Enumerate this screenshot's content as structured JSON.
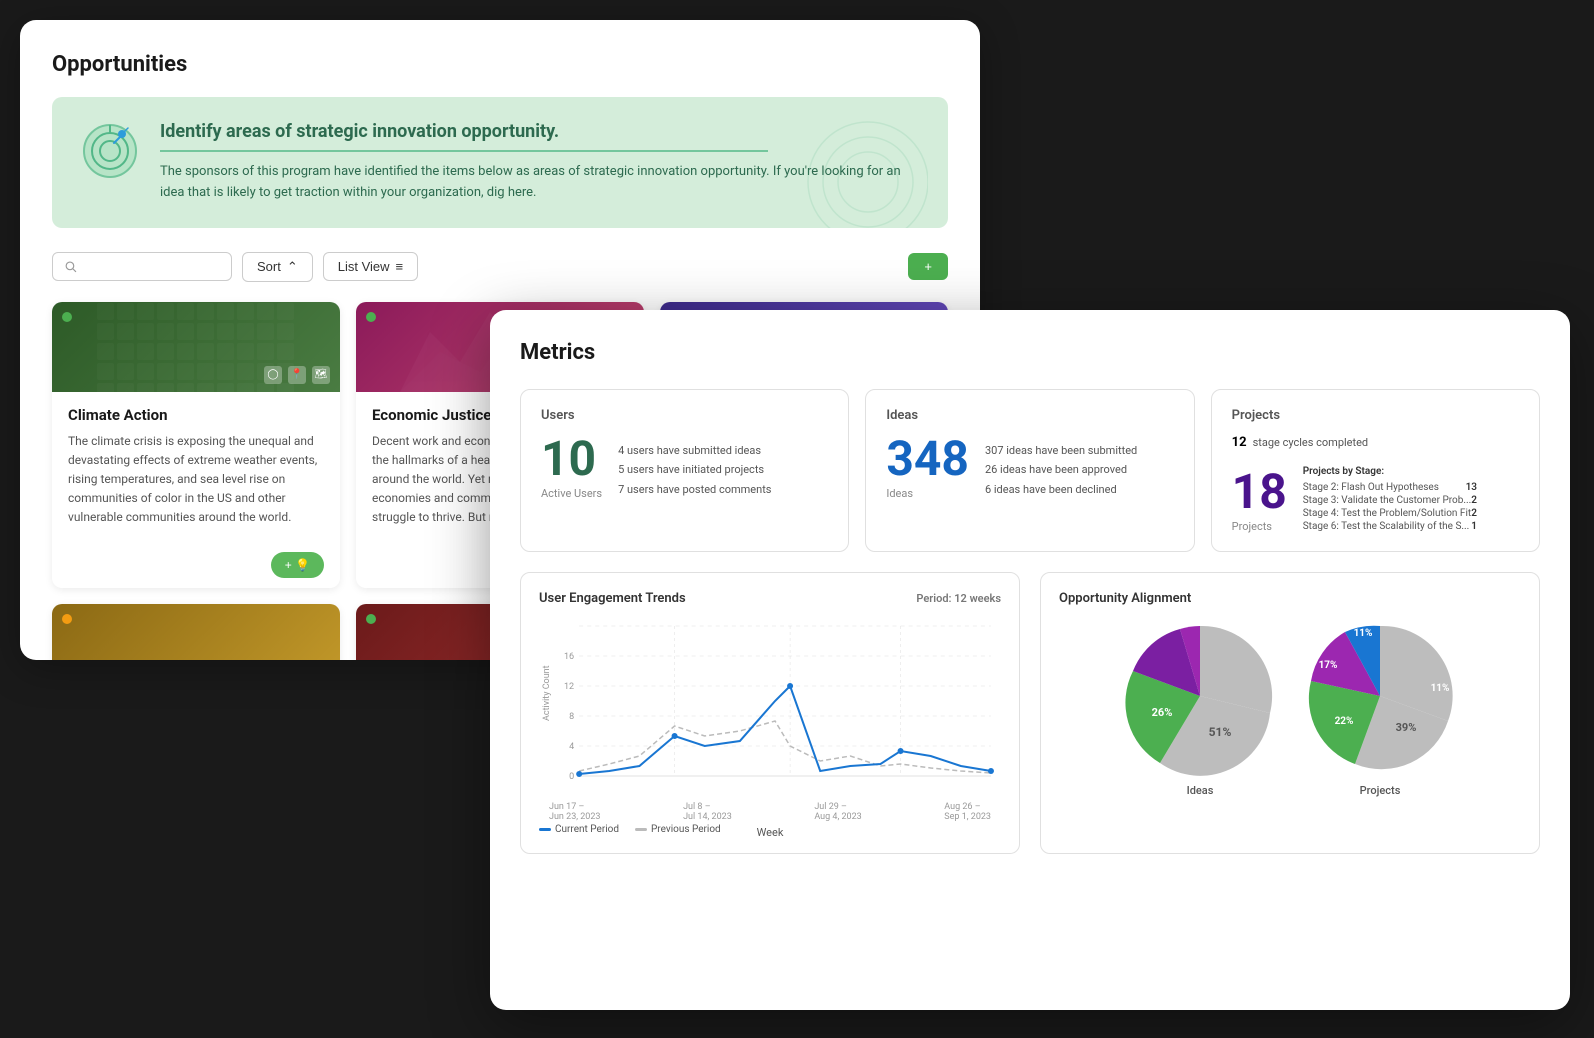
{
  "back_panel": {
    "title": "Opportunities",
    "banner": {
      "title": "Identify areas of strategic innovation opportunity.",
      "text": "The sponsors of this program have identified the items below as areas of strategic innovation opportunity. If you're looking for an idea that is likely to get traction within your organization, dig here."
    },
    "filter": {
      "sort_label": "Sort",
      "listview_label": "List View",
      "search_placeholder": ""
    },
    "cards": [
      {
        "id": "climate-action",
        "title": "Climate Action",
        "description": "The climate crisis is exposing the unequal and devastating effects of extreme weather events, rising temperatures, and sea level rise on communities of color in the US and other vulnerable communities around the world.",
        "header_class": "card-header-green",
        "add_label": "+ 💡"
      },
      {
        "id": "economic-justice",
        "title": "Economic Justice",
        "description": "Decent work and economic growth are among the hallmarks of a healthy, thriving community around the world. Yet many local and regional economies and communities continue to struggle to thrive. But m...",
        "header_class": "card-header-pink",
        "add_label": ""
      },
      {
        "id": "third-card",
        "title": "",
        "description": "",
        "header_class": "card-header-purple",
        "add_label": ""
      }
    ],
    "bottom_cards": [
      {
        "id": "card-gold",
        "header_class": "card-header-gold"
      },
      {
        "id": "card-darkred",
        "header_class": "card-header-darkred"
      }
    ]
  },
  "front_panel": {
    "title": "Metrics",
    "users": {
      "label": "Users",
      "number": "10",
      "sublabel": "Active Users",
      "details": [
        "4  users have submitted ideas",
        "5  users have initiated projects",
        "7  users have posted comments"
      ]
    },
    "ideas": {
      "label": "Ideas",
      "number": "348",
      "sublabel": "Ideas",
      "details": [
        "307  ideas have been submitted",
        "26   ideas have been approved",
        "6    ideas have been declined"
      ]
    },
    "projects": {
      "label": "Projects",
      "number": "18",
      "sublabel": "Projects",
      "cycle_count": "12",
      "cycle_text": "stage cycles completed",
      "stage_label": "Projects by Stage:",
      "stages": [
        {
          "name": "Stage 2: Flash Out Hypotheses",
          "count": 13
        },
        {
          "name": "Stage 3: Validate the Customer Prob...",
          "count": 2
        },
        {
          "name": "Stage 4: Test the Problem/Solution Fit",
          "count": 2
        },
        {
          "name": "Stage 6: Test the Scalability of the S...",
          "count": 1
        }
      ]
    },
    "engagement": {
      "title": "User Engagement Trends",
      "period": "Period: 12 weeks",
      "y_label": "Activity Count",
      "x_label": "Week",
      "legend_current": "Current Period",
      "legend_previous": "Previous Period",
      "x_axis": [
        "Jun 17 – Jun 23, 2023",
        "Jul 8 – Jul 14, 2023",
        "Jul 29 – Aug 4, 2023",
        "Aug 26 – Sep 1, 2023"
      ],
      "y_ticks": [
        0,
        4,
        8,
        12,
        16
      ]
    },
    "alignment": {
      "title": "Opportunity Alignment",
      "charts": [
        {
          "label": "Ideas",
          "segments": [
            {
              "percent": 51,
              "color": "#bdbdbd"
            },
            {
              "percent": 26,
              "color": "#4caf50"
            },
            {
              "percent": 11,
              "color": "#7b1fa2"
            },
            {
              "percent": 12,
              "color": "#9c27b0"
            }
          ],
          "labels": [
            {
              "percent": "51%",
              "color": "#555"
            },
            {
              "percent": "26%",
              "color": "#fff"
            }
          ]
        },
        {
          "label": "Projects",
          "segments": [
            {
              "percent": 39,
              "color": "#bdbdbd"
            },
            {
              "percent": 22,
              "color": "#4caf50"
            },
            {
              "percent": 11,
              "color": "#7b1fa2"
            },
            {
              "percent": 17,
              "color": "#9c27b0"
            },
            {
              "percent": 11,
              "color": "#1976d2"
            }
          ],
          "labels": [
            {
              "percent": "39%",
              "color": "#555"
            },
            {
              "percent": "22%",
              "color": "#fff"
            },
            {
              "percent": "17%",
              "color": "#fff"
            },
            {
              "percent": "11%",
              "color": "#fff"
            },
            {
              "percent": "11%",
              "color": "#fff"
            }
          ]
        }
      ]
    }
  }
}
